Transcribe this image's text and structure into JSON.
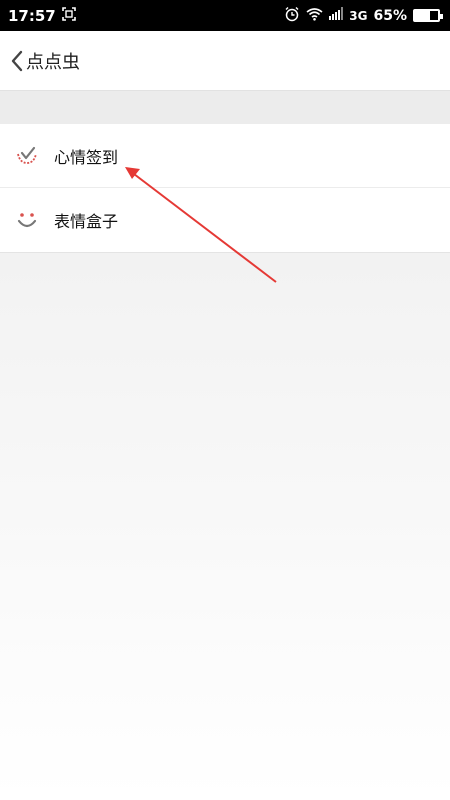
{
  "status_bar": {
    "time": "17:57",
    "network": "3G",
    "battery_percent": "65%",
    "battery_level": 0.65,
    "icons": [
      "screenshot-icon",
      "alarm-icon",
      "wifi-icon",
      "signal-icon",
      "battery-icon"
    ]
  },
  "nav": {
    "title": "点点虫"
  },
  "menu": {
    "items": [
      {
        "label": "心情签到",
        "icon": "checkmark-smile-icon"
      },
      {
        "label": "表情盒子",
        "icon": "smiley-face-icon"
      }
    ]
  },
  "annotation": {
    "color": "#e53935"
  }
}
